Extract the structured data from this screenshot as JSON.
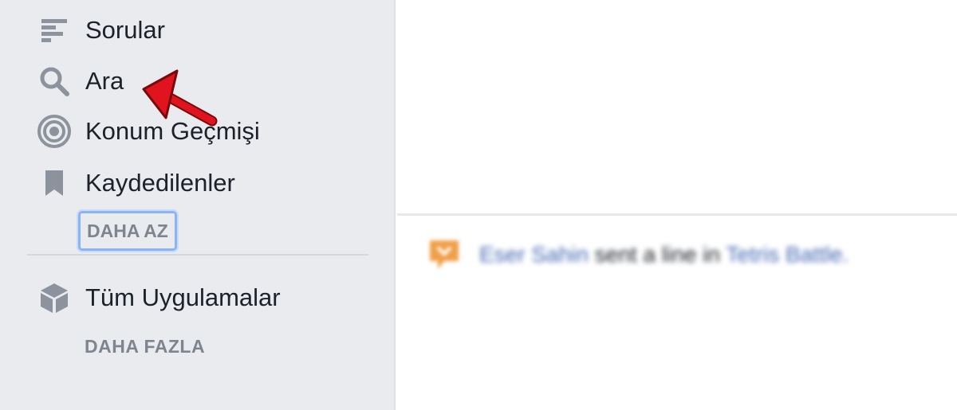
{
  "sidebar": {
    "items": [
      {
        "label": "Sorular",
        "icon": "lines-icon"
      },
      {
        "label": "Ara",
        "icon": "search-icon"
      },
      {
        "label": "Konum Geçmişi",
        "icon": "location-history-icon"
      },
      {
        "label": "Kaydedilenler",
        "icon": "bookmark-icon"
      }
    ],
    "less_label": "DAHA AZ",
    "all_apps": {
      "label": "Tüm Uygulamalar",
      "icon": "cube-icon"
    },
    "more_label": "DAHA FAZLA"
  },
  "annotation": {
    "arrow_color": "#e0141e",
    "points_to": "Ara"
  },
  "notification": {
    "icon": "chat-bubble-icon",
    "icon_color": "#f0a04b",
    "actor": "Eser Sahin",
    "text": "sent a line in",
    "target": "Tetris Battle."
  },
  "colors": {
    "sidebar_bg": "#e9ebee",
    "link": "#4267b2",
    "focus": "#8ab4f8"
  }
}
